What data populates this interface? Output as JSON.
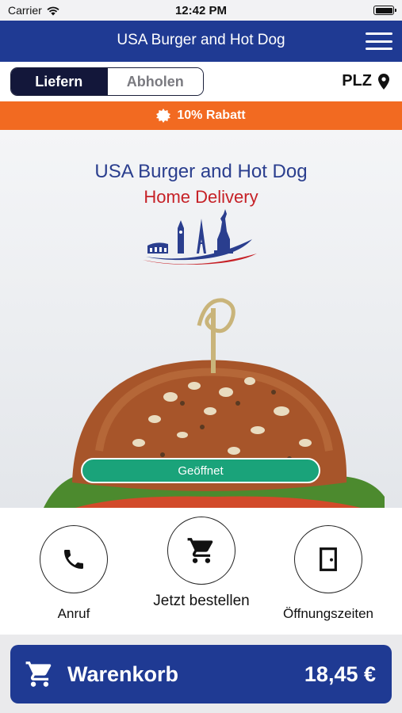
{
  "status_bar": {
    "carrier": "Carrier",
    "time": "12:42 PM"
  },
  "header": {
    "title": "USA Burger and Hot Dog"
  },
  "order_mode": {
    "deliver": "Liefern",
    "pickup": "Abholen",
    "selected": "Liefern"
  },
  "location": {
    "label": "PLZ"
  },
  "banner": {
    "discount": "10% Rabatt"
  },
  "hero": {
    "brand_name": "USA Burger and Hot Dog",
    "brand_sub": "Home Delivery",
    "open_status": "Geöffnet"
  },
  "actions": [
    {
      "label": "Anruf",
      "icon": "phone-icon"
    },
    {
      "label": "Jetzt bestellen",
      "icon": "cart-icon"
    },
    {
      "label": "Öffnungszeiten",
      "icon": "door-icon"
    }
  ],
  "cart": {
    "label": "Warenkorb",
    "total": "18,45 €"
  },
  "colors": {
    "primary": "#1f3a93",
    "accent": "#f26a21",
    "open": "#1aa37a",
    "brand_red": "#c62127"
  }
}
